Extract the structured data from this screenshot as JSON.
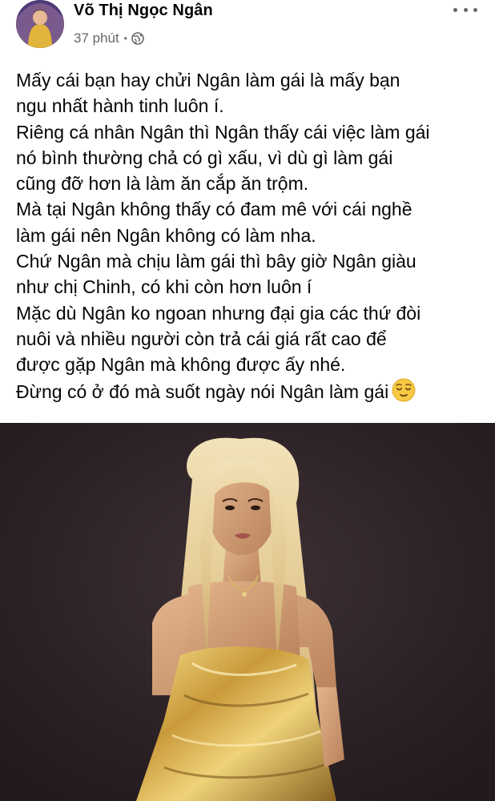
{
  "post": {
    "author": {
      "name": "Võ Thị Ngọc Ngân"
    },
    "meta": {
      "time": "37 phút",
      "separator": "•",
      "audience_icon": "globe-icon"
    },
    "more_icon": "more-horizontal-icon",
    "text_lines": [
      "Mấy cái bạn hay chửi Ngân làm gái là mấy bạn",
      "ngu nhất hành tinh luôn í.",
      "Riêng cá nhân Ngân thì Ngân thấy cái việc làm gái",
      "nó bình thường chả có gì xấu,  vì dù gì làm gái",
      "cũng đỡ hơn là làm ăn cắp ăn trộm.",
      "Mà tại Ngân không thấy có đam mê với cái nghề",
      "làm gái nên Ngân không có làm nha.",
      "Chứ Ngân mà chịu làm gái thì bây giờ Ngân giàu",
      "như chị Chinh, có khi còn hơn luôn í",
      "Mặc dù Ngân ko ngoan nhưng đại gia các thứ đòi",
      "nuôi và nhiều người còn trả cái giá rất cao để",
      "được gặp Ngân mà không được ấy nhé.",
      "Đừng có ở đó mà suốt ngày nói Ngân làm gái"
    ],
    "trailing_emoji": "relieved-face-emoji",
    "photo": {
      "subject": "woman-portrait"
    }
  },
  "colors": {
    "name": "#050505",
    "meta": "#65676b",
    "photo_bg": "#2c2226",
    "hair": "#e6cf9a",
    "dress": "#c99a3a"
  }
}
